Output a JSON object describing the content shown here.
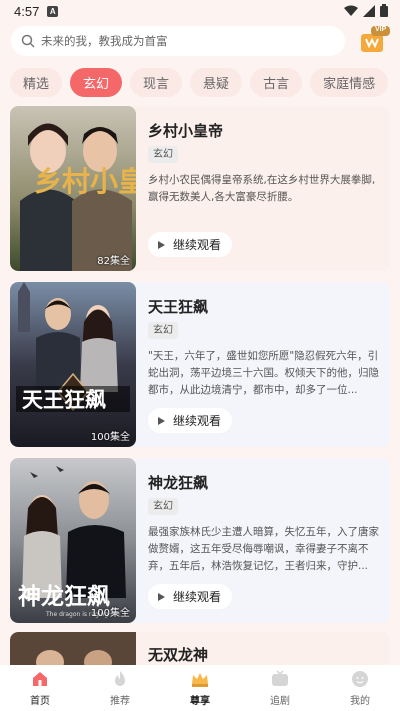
{
  "status": {
    "time": "4:57"
  },
  "search": {
    "placeholder": "未来的我，教我成为首富"
  },
  "vip": {
    "badge": "VIP"
  },
  "tabs": [
    {
      "label": "精选",
      "active": false
    },
    {
      "label": "玄幻",
      "active": true
    },
    {
      "label": "现言",
      "active": false
    },
    {
      "label": "悬疑",
      "active": false
    },
    {
      "label": "古言",
      "active": false
    },
    {
      "label": "家庭情感",
      "active": false
    }
  ],
  "dramas": [
    {
      "title": "乡村小皇帝",
      "genre": "玄幻",
      "description": "乡村小农民偶得皇帝系统,在这乡村世界大展拳脚,赢得无数美人,各大富豪尽折腰。",
      "episodes": "82集全",
      "cover_text": "乡村小皇",
      "continue_label": "继续观看"
    },
    {
      "title": "天王狂飙",
      "genre": "玄幻",
      "description": "\"天王，六年了，盛世如您所愿\"隐忍假死六年，引蛇出洞，荡平边境三十六国。权倾天下的他，归隐都市，从此边境清宁，都市中，却多了一位...",
      "episodes": "100集全",
      "cover_text": "天王狂飙",
      "continue_label": "继续观看"
    },
    {
      "title": "神龙狂飙",
      "genre": "玄幻",
      "description": "最强家族林氏少主遭人暗算，失忆五年，入了唐家做赘婿，这五年受尽侮辱嘲讽，幸得妻子不离不弃，五年后，林浩恢复记忆，王者归来，守护...",
      "episodes": "100集全",
      "cover_text": "神龙狂飙",
      "cover_subtext": "The dragon is raging",
      "continue_label": "继续观看"
    },
    {
      "title": "无双龙神"
    }
  ],
  "nav": [
    {
      "label": "首页",
      "active": false
    },
    {
      "label": "推荐",
      "active": false
    },
    {
      "label": "尊享",
      "active": true
    },
    {
      "label": "追剧",
      "active": false
    },
    {
      "label": "我的",
      "active": false
    }
  ]
}
